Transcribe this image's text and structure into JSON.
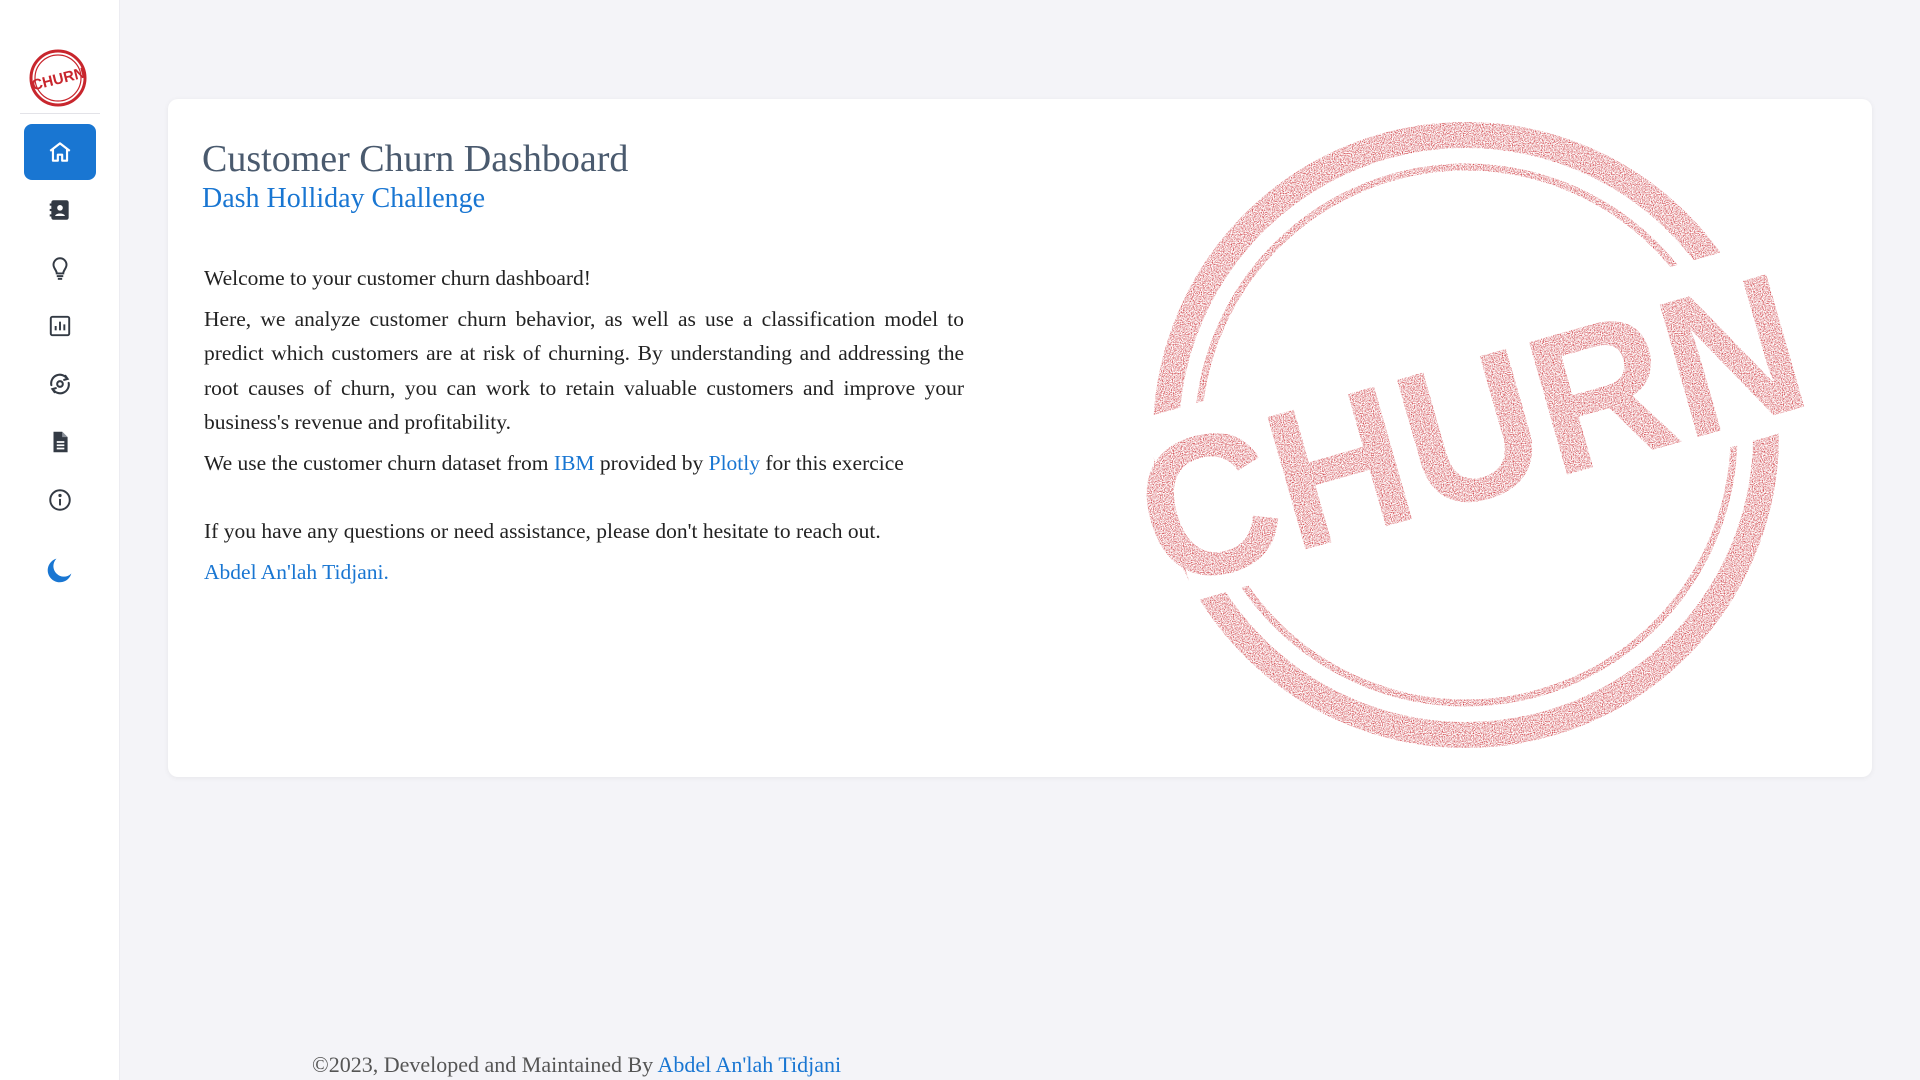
{
  "sidebar": {
    "logo_text": "CHURN",
    "items": [
      {
        "name": "home",
        "icon": "home-icon",
        "active": true
      },
      {
        "name": "contacts",
        "icon": "contact-card-icon",
        "active": false
      },
      {
        "name": "insights",
        "icon": "lightbulb-icon",
        "active": false
      },
      {
        "name": "analytics",
        "icon": "bar-chart-icon",
        "active": false
      },
      {
        "name": "prediction",
        "icon": "eye-refresh-icon",
        "active": false
      },
      {
        "name": "documents",
        "icon": "document-icon",
        "active": false
      },
      {
        "name": "about",
        "icon": "info-icon",
        "active": false
      }
    ],
    "theme_toggle_icon": "moon-icon"
  },
  "main": {
    "title": "Customer Churn Dashboard",
    "subtitle": "Dash Holliday Challenge",
    "welcome": "Welcome to your customer churn dashboard!",
    "description": "Here, we analyze customer churn behavior, as well as use a classification model to predict which customers are at risk of churning. By understanding and addressing the root causes of churn, you can work to retain valuable customers and improve your business's revenue and profitability.",
    "dataset_prefix": "We use the customer churn dataset from ",
    "dataset_link_ibm": "IBM",
    "dataset_middle": " provided by ",
    "dataset_link_plotly": "Plotly",
    "dataset_suffix": " for this exercice",
    "help_text": "If you have any questions or need assistance, please don't hesitate to reach out.",
    "author_link": "Abdel An'lah Tidjani.",
    "stamp_text": "CHURN"
  },
  "footer": {
    "prefix": "©2023, Developed and Maintained By ",
    "author": "Abdel An'lah Tidjani"
  },
  "colors": {
    "accent": "#1976d2",
    "stamp_red": "#c8262d",
    "background": "#f4f4f8"
  }
}
